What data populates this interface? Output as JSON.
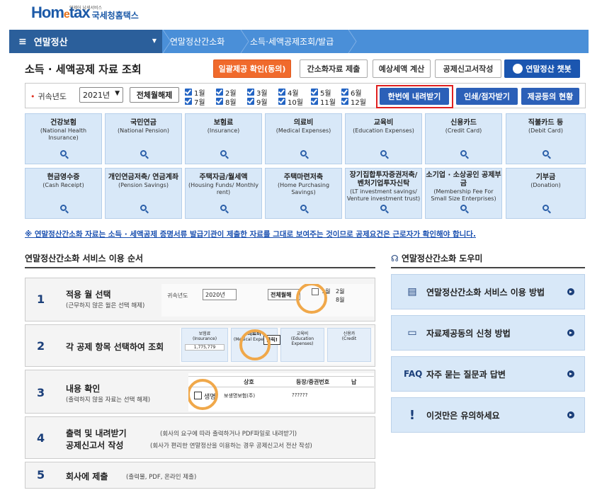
{
  "logo": {
    "tagline": "언제어 납세서비스",
    "home": "Hom",
    "e": "e",
    "tax": "tax",
    "nts": "국세청홈택스"
  },
  "nav": {
    "menu": "연말정산",
    "crumbs": [
      "연말정산간소화",
      "소득·세액공제조회/발급"
    ]
  },
  "page_title": "소득 · 세액공제 자료 조회",
  "toolbar": {
    "notice": "일괄제공 확인(동의)",
    "submit": "간소화자료 제출",
    "calc": "예상세액 계산",
    "report": "공제신고서작성",
    "chatbot": "연말정산 챗봇"
  },
  "filter": {
    "label": "귀속년도",
    "year": "2021년",
    "unselect": "전체월해제",
    "months": [
      "1월",
      "2월",
      "3월",
      "4월",
      "5월",
      "6월",
      "7월",
      "8월",
      "9월",
      "10월",
      "11월",
      "12월"
    ],
    "download_all": "한번에 내려받기",
    "print": "인쇄/점자받기",
    "status": "제공등의 현황"
  },
  "categories": [
    {
      "kr": "건강보험",
      "en": "(National Health Insurance)"
    },
    {
      "kr": "국민연금",
      "en": "(National Pension)"
    },
    {
      "kr": "보험료",
      "en": "(Insurance)"
    },
    {
      "kr": "의료비",
      "en": "(Medical Expenses)"
    },
    {
      "kr": "교육비",
      "en": "(Education Expenses)"
    },
    {
      "kr": "신용카드",
      "en": "(Credit Card)"
    },
    {
      "kr": "직불카드 등",
      "en": "(Debit Card)"
    },
    {
      "kr": "현금영수증",
      "en": "(Cash Receipt)"
    },
    {
      "kr": "개인연금저축/ 연금계좌",
      "en": "(Pension Savings)"
    },
    {
      "kr": "주택자금/월세액",
      "en": "(Housing Funds/ Monthly rent)"
    },
    {
      "kr": "주택마련저축",
      "en": "(Home Purchasing Savings)"
    },
    {
      "kr": "장기집합투자증권저축/ 벤처기업투자신탁",
      "en": "(LT investment savings/ Venture investment trust)"
    },
    {
      "kr": "소기업 · 소상공인 공제부금",
      "en": "(Membership Fee For Small Size Enterprises)"
    },
    {
      "kr": "기부금",
      "en": "(Donation)"
    }
  ],
  "notice": "※ 연말정산간소화 자료는 소득 · 세액공제 증명서류 발급기관이 제출한 자료를 그대로 보여주는 것이므로 공제요건은 근로자가 확인해야 합니다.",
  "steps": {
    "title": "연말정산간소화 서비스 이용 순서",
    "items": [
      {
        "num": "1",
        "title": "적용 월 선택",
        "sub": "(근무하지 않은 월은 선택 해제)"
      },
      {
        "num": "2",
        "title": "각 공제 항목 선택하여 조회",
        "sub": ""
      },
      {
        "num": "3",
        "title": "내용 확인",
        "sub": "(출력하지 않을 자료는 선택 해제)"
      },
      {
        "num": "4",
        "title": "출력 및 내려받기",
        "sub": "(회사의 요구에 따라 출력하거나 PDF파일로 내려받기)",
        "title2": "공제신고서 작성",
        "sub2": "(회사가 편리한 연말정산을 이용하는 경우 공제신고서 전산 작성)"
      },
      {
        "num": "5",
        "title": "회사에 제출",
        "sub": "(출력물, PDF, 온라인 제출)"
      }
    ],
    "demo1": {
      "label": "귀속년도",
      "year": "2020년",
      "unselect": "전체월해",
      "m1": "1월",
      "m2": "2월",
      "m8": "8월"
    },
    "demo2": {
      "a_kr": "보험료",
      "a_en": "(Insurance)",
      "a_val": "1,775,779",
      "b_kr": "의료비",
      "b_en": "(Medical Expenses)",
      "c_kr": "교육비",
      "c_en": "(Education Expenses)",
      "d_kr": "신용카",
      "d_en": "(Credit",
      "click": "클릭!"
    },
    "demo3": {
      "h1": "상호",
      "h2": "등장/증권번호",
      "h3": "납",
      "row1a": "생명",
      "row1b": "보생명보험(주)",
      "row1c": "??????"
    }
  },
  "help": {
    "title": "연말정산간소화 도우미",
    "items": [
      "연말정산간소화 서비스 이용 방법",
      "자료제공동의 신청 방법",
      "자주 묻는 질문과 답변",
      "이것만은 유의하세요"
    ],
    "faq": "FAQ",
    "warn": "!"
  }
}
